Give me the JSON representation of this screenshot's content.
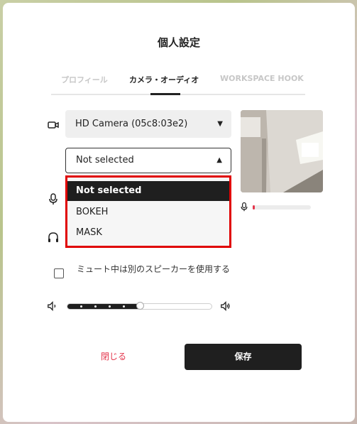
{
  "dialog": {
    "title": "個人設定"
  },
  "tabs": [
    {
      "label": "プロフィール",
      "active": false
    },
    {
      "label": "カメラ・オーディオ",
      "active": true
    },
    {
      "label": "WORKSPACE HOOK",
      "active": false
    }
  ],
  "camera": {
    "selected": "HD Camera (05c8:03e2)"
  },
  "background_effect": {
    "selected": "Not selected",
    "options": [
      {
        "label": "Not selected",
        "selected": true
      },
      {
        "label": "BOKEH",
        "selected": false
      },
      {
        "label": "MASK",
        "selected": false
      }
    ]
  },
  "microphone": {
    "level_fraction": 0.02
  },
  "mute_option": {
    "label": "ミュート中は別のスピーカーを使用する",
    "checked": false
  },
  "volume": {
    "level_fraction": 0.5
  },
  "footer": {
    "close_label": "閉じる",
    "save_label": "保存"
  },
  "colors": {
    "accent": "#e4364c",
    "dark": "#1f1f1f",
    "highlight_border": "#e00000"
  },
  "icons": [
    "camera-icon",
    "microphone-icon",
    "headphones-icon",
    "speaker-low-icon",
    "speaker-high-icon",
    "caret-down-icon",
    "caret-up-icon"
  ]
}
